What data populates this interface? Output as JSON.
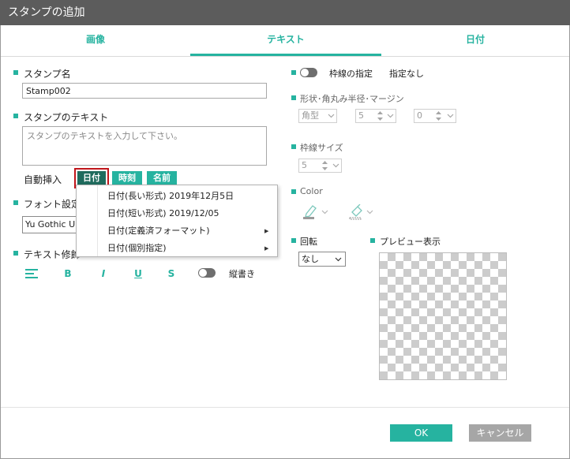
{
  "window": {
    "title": "スタンプの追加"
  },
  "tabs": [
    {
      "label": "画像",
      "active": false
    },
    {
      "label": "テキスト",
      "active": true
    },
    {
      "label": "日付",
      "active": false
    }
  ],
  "left": {
    "stamp_name": {
      "label": "スタンプ名",
      "value": "Stamp002"
    },
    "stamp_text": {
      "label": "スタンプのテキスト",
      "placeholder": "スタンプのテキストを入力して下さい。"
    },
    "auto_insert": {
      "label": "自動挿入",
      "chips": [
        "日付",
        "時刻",
        "名前"
      ]
    },
    "font": {
      "label": "フォント設定",
      "value": "Yu Gothic UI"
    },
    "text_style": {
      "label": "テキスト修飾",
      "buttons": [
        "B",
        "I",
        "U",
        "S"
      ],
      "vertical_label": "縦書き"
    }
  },
  "dropdown_menu": {
    "items": [
      {
        "label": "日付(長い形式) 2019年12月5日",
        "submenu": false
      },
      {
        "label": "日付(短い形式) 2019/12/05",
        "submenu": false
      },
      {
        "label": "日付(定義済フォーマット)",
        "submenu": true
      },
      {
        "label": "日付(個別指定)",
        "submenu": true
      }
    ],
    "submenu_arrow": "▶"
  },
  "right": {
    "border": {
      "label": "枠線の指定",
      "status": "指定なし"
    },
    "shape": {
      "label": "形状･角丸み半径･マージン",
      "shape_value": "角型",
      "radius_value": "5",
      "margin_value": "0"
    },
    "border_size": {
      "label": "枠線サイズ",
      "value": "5"
    },
    "color": {
      "label": "Color"
    },
    "rotation": {
      "label": "回転",
      "value": "なし"
    },
    "preview": {
      "label": "プレビュー表示"
    }
  },
  "footer": {
    "ok_label": "OK",
    "cancel_label": "キャンセル"
  },
  "colors": {
    "accent": "#26b3a0",
    "titlebar": "#5c5c5c",
    "highlight_border": "#c0161b",
    "cancel": "#a6a6a6"
  }
}
